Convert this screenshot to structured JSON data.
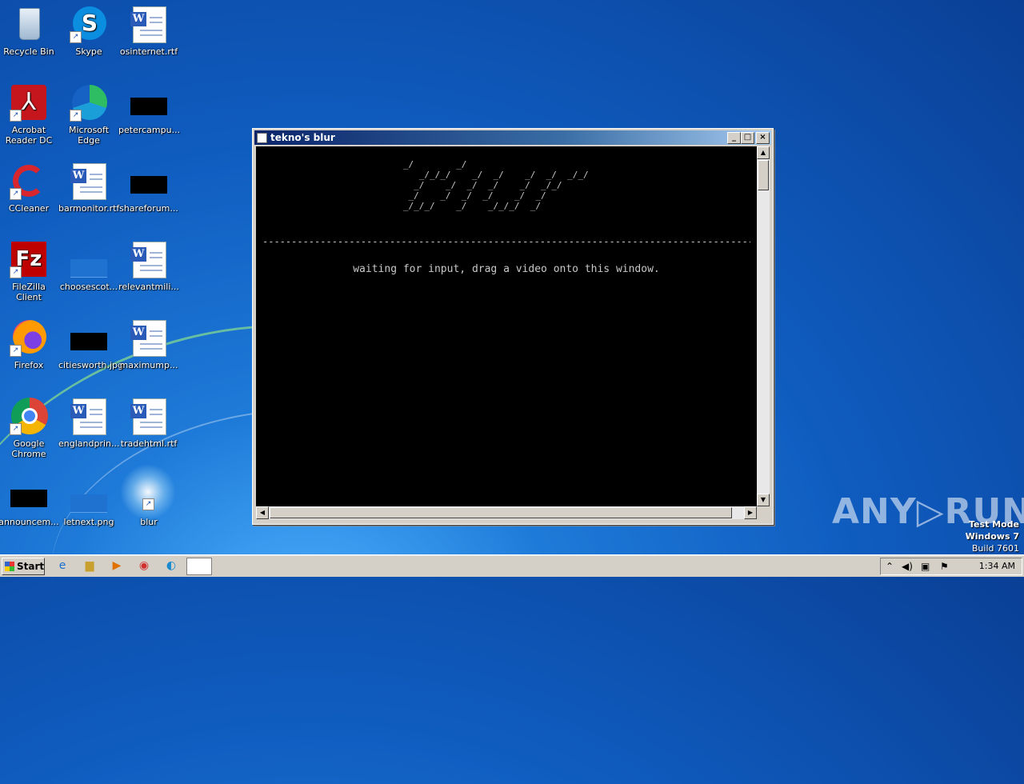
{
  "desktop": {
    "icons": [
      {
        "label": "Recycle Bin",
        "icon": "recycle-bin-icon"
      },
      {
        "label": "Skype",
        "icon": "skype-icon"
      },
      {
        "label": "osinternet.rtf",
        "icon": "word-document-icon"
      },
      {
        "label": "Acrobat Reader DC",
        "icon": "acrobat-icon"
      },
      {
        "label": "Microsoft Edge",
        "icon": "edge-icon"
      },
      {
        "label": "petercampu...",
        "icon": "black-file-icon"
      },
      {
        "label": "CCleaner",
        "icon": "ccleaner-icon"
      },
      {
        "label": "barmonitor.rtf",
        "icon": "word-document-icon"
      },
      {
        "label": "shareforum...",
        "icon": "black-file-icon"
      },
      {
        "label": "FileZilla Client",
        "icon": "filezilla-icon"
      },
      {
        "label": "choosescot...",
        "icon": "blank-file-icon"
      },
      {
        "label": "relevantmili...",
        "icon": "word-document-icon"
      },
      {
        "label": "Firefox",
        "icon": "firefox-icon"
      },
      {
        "label": "citiesworth.jpg",
        "icon": "black-file-icon"
      },
      {
        "label": "maximump...",
        "icon": "word-document-icon"
      },
      {
        "label": "Google Chrome",
        "icon": "chrome-icon"
      },
      {
        "label": "englandprin...",
        "icon": "word-document-icon"
      },
      {
        "label": "tradehtml.rtf",
        "icon": "word-document-icon"
      },
      {
        "label": "announcem...",
        "icon": "black-file-icon"
      },
      {
        "label": "letnext.png",
        "icon": "blank-file-icon"
      },
      {
        "label": "blur",
        "icon": "shortcut-icon"
      }
    ]
  },
  "window": {
    "title": "tekno's blur",
    "ascii_art": "     _/        _/                                \n    _/_/_/    _/  _/    _/  _/  _/_/     \n   _/    _/  _/  _/    _/  _/_/          \n  _/    _/  _/  _/    _/  _/             \n _/_/_/    _/    _/_/_/  _/              ",
    "divider": "------------------------------------------------------------------------------------------------------------------",
    "status": "waiting for input, drag a video onto this window.",
    "controls": {
      "minimize": "_",
      "maximize": "□",
      "close": "×"
    }
  },
  "watermark": {
    "text": "ANY▷RUN"
  },
  "os_info": {
    "line1": "Test Mode",
    "line2": "Windows 7",
    "line3": "Build 7601"
  },
  "taskbar": {
    "start_label": "Start",
    "clock": "1:34 AM"
  }
}
